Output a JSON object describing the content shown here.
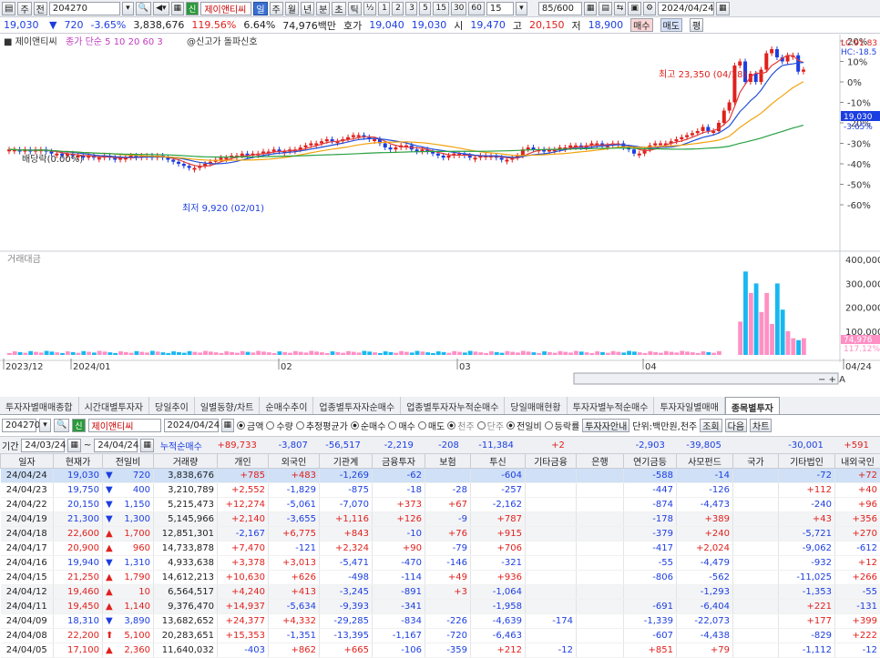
{
  "toolbar": {
    "period": "주",
    "code": "204270",
    "name": "제이앤티씨",
    "active_period": "일",
    "periods": [
      "일",
      "주",
      "월",
      "년",
      "분",
      "초",
      "틱"
    ],
    "ticks": [
      "½",
      "1",
      "2",
      "3",
      "5",
      "15",
      "30",
      "60",
      "15"
    ],
    "count": "85/600",
    "date": "2024/04/24"
  },
  "quote": {
    "price": "19,030",
    "change": "720",
    "rate": "-3.65%",
    "volume": "3,838,676",
    "vol_ratio": "119.56%",
    "turnover": "6.64%",
    "amount": "74,976백만",
    "ask_label": "호가",
    "bid": "19,040",
    "ask": "19,030",
    "open_label": "시",
    "open": "19,470",
    "high_label": "고",
    "high": "20,150",
    "low_label": "저",
    "low": "18,900",
    "buy": "매수",
    "sell": "매도",
    "eval": "평"
  },
  "legend": {
    "name": "제이앤티씨",
    "ma": "종가 단순 5 10 20 60 3",
    "signal": "@신고가 돌파신호",
    "vol_title": "거래대금"
  },
  "annotations": {
    "high": "최고 23,350 (04/18)",
    "low": "최저 9,920 (02/01)",
    "dividend": "배당락(0.00%)",
    "lc": "LC:91.83",
    "hc": "HC:-18.5",
    "last": "19,030",
    "last_rate": "-3.65%",
    "vlast": "74,976",
    "vrate": "117.12%"
  },
  "y_ticks": [
    "20%",
    "10%",
    "0%",
    "-10%",
    "-20%",
    "-30%",
    "-40%",
    "-50%",
    "-60%"
  ],
  "vol_ticks": [
    "400,000",
    "300,000",
    "200,000",
    "100,000"
  ],
  "x_ticks": [
    "2023/12",
    "2024/01",
    "02",
    "03",
    "04",
    "04/24"
  ],
  "colors": {
    "up": "#e0201c",
    "down": "#1c3ee0",
    "ma5": "#e03c3c",
    "ma10": "#2050d8",
    "ma20": "#f2a20a",
    "ma60": "#26a040",
    "vol_up": "#ff8fc4",
    "vol_down": "#18b8f0"
  },
  "tabs": [
    "투자자별매매종합",
    "시간대별투자자",
    "당일추이",
    "일별동향/차트",
    "순매수추이",
    "업종별투자자순매수",
    "업종별투자자누적순매수",
    "당일매매현황",
    "투자자별누적순매수",
    "투자자일별매매",
    "종목별투자"
  ],
  "controls": {
    "code": "204270",
    "name": "제이앤티씨",
    "date": "2024/04/24",
    "r1": [
      "금액",
      "수량",
      "추정평균가"
    ],
    "r2": [
      "순매수",
      "매수",
      "매도"
    ],
    "r3": [
      "천주",
      "단주"
    ],
    "r4": [
      "전일비",
      "등락률"
    ],
    "btn_info": "투자자안내",
    "unit": "단위:백만원,천주",
    "query": "조회",
    "next": "다음",
    "chart": "차트"
  },
  "period": {
    "label": "기간",
    "from": "24/03/24",
    "to": "24/04/24",
    "cum": "누적순매수",
    "cum_vals": [
      "+89,733",
      "-3,807",
      "-56,517",
      "-2,219",
      "-208",
      "-11,384",
      "+2",
      "",
      "-2,903",
      "-39,805",
      "",
      "-30,001",
      "+591"
    ]
  },
  "table": {
    "headers": [
      "일자",
      "현재가",
      "전일비",
      "거래량",
      "개인",
      "외국인",
      "기관계",
      "금융투자",
      "보험",
      "투신",
      "기타금융",
      "은행",
      "연기금등",
      "사모펀드",
      "국가",
      "기타법인",
      "내외국인"
    ],
    "rows": [
      [
        "24/04/24",
        "19,030",
        "▼",
        "720",
        "3,838,676",
        "+785",
        "+483",
        "-1,269",
        "-62",
        "",
        "-604",
        "",
        "",
        "-588",
        "-14",
        "",
        "-72",
        "+72"
      ],
      [
        "24/04/23",
        "19,750",
        "▼",
        "400",
        "3,210,789",
        "+2,552",
        "-1,829",
        "-875",
        "-18",
        "-28",
        "-257",
        "",
        "",
        "-447",
        "-126",
        "",
        "+112",
        "+40"
      ],
      [
        "24/04/22",
        "20,150",
        "▼",
        "1,150",
        "5,215,473",
        "+12,274",
        "-5,061",
        "-7,070",
        "+373",
        "+67",
        "-2,162",
        "",
        "",
        "-874",
        "-4,473",
        "",
        "-240",
        "+96"
      ],
      [
        "24/04/19",
        "21,300",
        "▼",
        "1,300",
        "5,145,966",
        "+2,140",
        "-3,655",
        "+1,116",
        "+126",
        "-9",
        "+787",
        "",
        "",
        "-178",
        "+389",
        "",
        "+43",
        "+356"
      ],
      [
        "24/04/18",
        "22,600",
        "▲",
        "1,700",
        "12,851,301",
        "-2,167",
        "+6,775",
        "+843",
        "-10",
        "+76",
        "+915",
        "",
        "",
        "-379",
        "+240",
        "",
        "-5,721",
        "+270"
      ],
      [
        "24/04/17",
        "20,900",
        "▲",
        "960",
        "14,733,878",
        "+7,470",
        "-121",
        "+2,324",
        "+90",
        "-79",
        "+706",
        "",
        "",
        "-417",
        "+2,024",
        "",
        "-9,062",
        "-612"
      ],
      [
        "24/04/16",
        "19,940",
        "▼",
        "1,310",
        "4,933,638",
        "+3,378",
        "+3,013",
        "-5,471",
        "-470",
        "-146",
        "-321",
        "",
        "",
        "-55",
        "-4,479",
        "",
        "-932",
        "+12"
      ],
      [
        "24/04/15",
        "21,250",
        "▲",
        "1,790",
        "14,612,213",
        "+10,630",
        "+626",
        "-498",
        "-114",
        "+49",
        "+936",
        "",
        "",
        "-806",
        "-562",
        "",
        "-11,025",
        "+266"
      ],
      [
        "24/04/12",
        "19,460",
        "▲",
        "10",
        "6,564,517",
        "+4,240",
        "+413",
        "-3,245",
        "-891",
        "+3",
        "-1,064",
        "",
        "",
        "",
        "-1,293",
        "",
        "-1,353",
        "-55"
      ],
      [
        "24/04/11",
        "19,450",
        "▲",
        "1,140",
        "9,376,470",
        "+14,937",
        "-5,634",
        "-9,393",
        "-341",
        "",
        "-1,958",
        "",
        "",
        "-691",
        "-6,404",
        "",
        "+221",
        "-131"
      ],
      [
        "24/04/09",
        "18,310",
        "▼",
        "3,890",
        "13,682,652",
        "+24,377",
        "+4,332",
        "-29,285",
        "-834",
        "-226",
        "-4,639",
        "-174",
        "",
        "-1,339",
        "-22,073",
        "",
        "+177",
        "+399"
      ],
      [
        "24/04/08",
        "22,200",
        "⬆",
        "5,100",
        "20,283,651",
        "+15,353",
        "-1,351",
        "-13,395",
        "-1,167",
        "-720",
        "-6,463",
        "",
        "",
        "-607",
        "-4,438",
        "",
        "-829",
        "+222"
      ],
      [
        "24/04/05",
        "17,100",
        "▲",
        "2,360",
        "11,640,032",
        "-403",
        "+862",
        "+665",
        "-106",
        "-359",
        "+212",
        "-12",
        "",
        "+851",
        "+79",
        "",
        "-1,112",
        "-12"
      ]
    ]
  }
}
